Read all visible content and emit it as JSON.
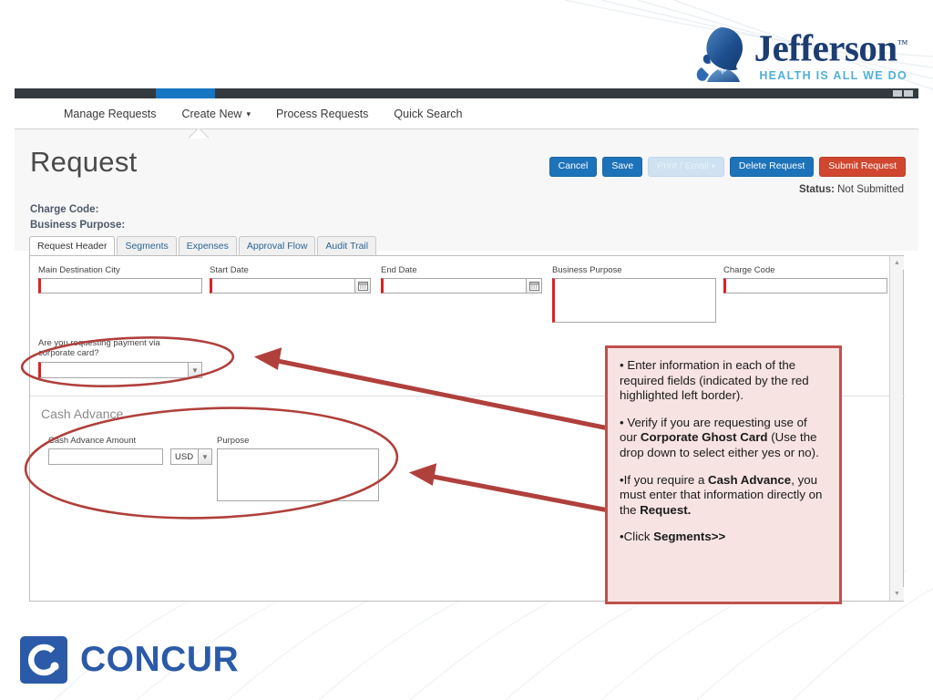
{
  "brand": {
    "jefferson_name": "Jefferson",
    "jefferson_tm": "™",
    "jefferson_tagline": "HEALTH IS ALL WE DO",
    "concur_word": "CONCUR",
    "concur_mark_letter": "C.",
    "jefferson_blue": "#1b3d72",
    "jefferson_accent": "#4fb0d8",
    "concur_blue": "#2b5aa8"
  },
  "nav": {
    "items": [
      {
        "label": "Manage Requests",
        "caret": false
      },
      {
        "label": "Create New",
        "caret": true
      },
      {
        "label": "Process Requests",
        "caret": false
      },
      {
        "label": "Quick Search",
        "caret": false
      }
    ]
  },
  "header": {
    "page_title": "Request",
    "charge_code_label": "Charge Code:",
    "business_purpose_label": "Business Purpose:",
    "status_label": "Status:",
    "status_value": "Not Submitted",
    "buttons": [
      {
        "label": "Cancel",
        "style": "primary"
      },
      {
        "label": "Save",
        "style": "primary"
      },
      {
        "label": "Print / Email",
        "style": "disabled",
        "caret": "▾"
      },
      {
        "label": "Delete Request",
        "style": "primary"
      },
      {
        "label": "Submit Request",
        "style": "danger"
      }
    ]
  },
  "tabs": [
    {
      "label": "Request Header",
      "active": true
    },
    {
      "label": "Segments",
      "active": false
    },
    {
      "label": "Expenses",
      "active": false
    },
    {
      "label": "Approval Flow",
      "active": false
    },
    {
      "label": "Audit Trail",
      "active": false
    }
  ],
  "form": {
    "fields": {
      "main_destination_city": {
        "label": "Main Destination City",
        "value": "",
        "required": true
      },
      "start_date": {
        "label": "Start Date",
        "value": "",
        "required": true
      },
      "end_date": {
        "label": "End Date",
        "value": "",
        "required": true
      },
      "business_purpose": {
        "label": "Business Purpose",
        "value": "",
        "required": true
      },
      "charge_code": {
        "label": "Charge Code",
        "value": "",
        "required": true
      },
      "corporate_card": {
        "label": "Are you requesting payment via corporate card?",
        "value": "",
        "required": true
      }
    },
    "cash_advance": {
      "section_title": "Cash Advance",
      "amount_label": "Cash Advance Amount",
      "amount_value": "",
      "currency_value": "USD",
      "purpose_label": "Purpose",
      "purpose_value": ""
    },
    "required_marker_color": "#e02020"
  },
  "annotation": {
    "border_color": "#c0504d",
    "fill_color": "#f6e3e2",
    "paragraphs": [
      {
        "parts": [
          {
            "text": "• Enter information in each of the required fields (indicated by the red highlighted left border).",
            "bold": false
          }
        ]
      },
      {
        "parts": [
          {
            "text": "• Verify if you are requesting use of our ",
            "bold": false
          },
          {
            "text": "Corporate Ghost Card",
            "bold": true
          },
          {
            "text": " (Use the drop down to select either yes or no).",
            "bold": false
          }
        ]
      },
      {
        "parts": [
          {
            "text": "•If you require a ",
            "bold": false
          },
          {
            "text": "Cash Advance",
            "bold": true
          },
          {
            "text": ", you must enter that information directly on the ",
            "bold": false
          },
          {
            "text": "Request.",
            "bold": true
          }
        ]
      },
      {
        "parts": [
          {
            "text": "•Click ",
            "bold": false
          },
          {
            "text": "Segments>>",
            "bold": true
          }
        ]
      }
    ]
  }
}
